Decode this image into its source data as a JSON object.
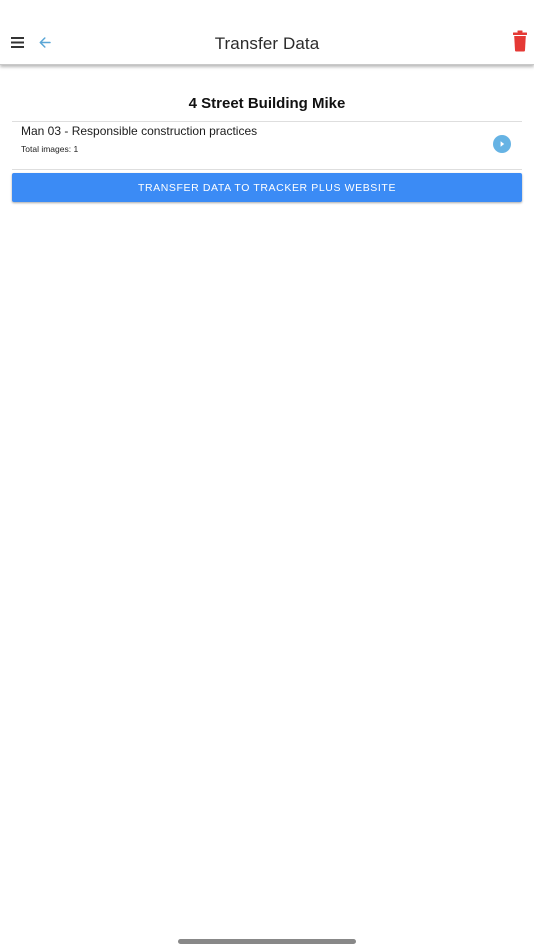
{
  "header": {
    "title": "Transfer Data",
    "menu_icon": "hamburger-menu-icon",
    "back_icon": "arrow-left-icon",
    "delete_icon": "trash-icon"
  },
  "project": {
    "title": "4 Street Building Mike"
  },
  "items": [
    {
      "title": "Man 03 - Responsible construction practices",
      "subtitle": "Total images: 1",
      "icon": "chevron-right-circle-icon"
    }
  ],
  "actions": {
    "transfer_label": "TRANSFER DATA TO TRACKER PLUS WEBSITE"
  },
  "colors": {
    "accent": "#3b8bf5",
    "back_arrow": "#5aa6d6",
    "chevron_circle": "#66b3e4",
    "delete": "#e53935"
  }
}
